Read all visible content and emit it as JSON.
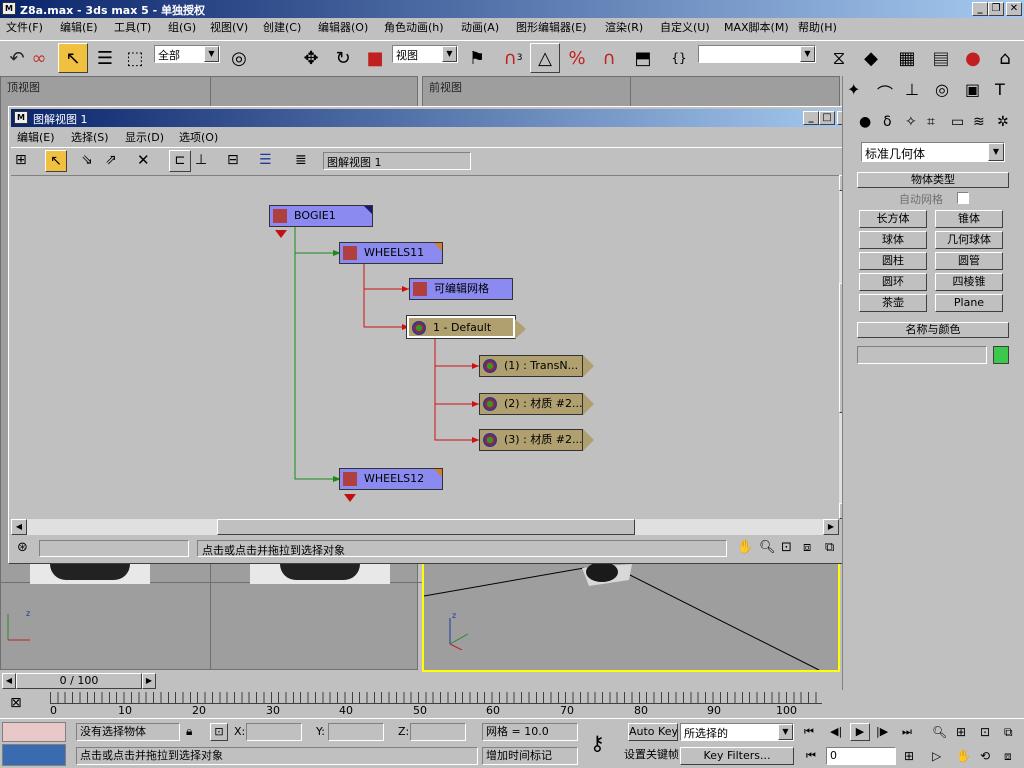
{
  "app": {
    "title": "Z8a.max - 3ds max 5 - 单独授权",
    "min": "_",
    "restore": "❐",
    "close": "✕"
  },
  "menu": [
    "文件(F)",
    "编辑(E)",
    "工具(T)",
    "组(G)",
    "视图(V)",
    "创建(C)",
    "编辑器(O)",
    "角色动画(h)",
    "动画(A)",
    "图形编辑器(E)",
    "渲染(R)",
    "自定义(U)",
    "MAX脚本(M)",
    "帮助(H)"
  ],
  "toolbar": {
    "selection_filter": "全部",
    "ref_coord": "视图",
    "named_selection": "",
    "snap_label": "3"
  },
  "viewports": {
    "top": "顶视图",
    "front": "前视图"
  },
  "schematic": {
    "title": "图解视图 1",
    "menu": [
      "编辑(E)",
      "选择(S)",
      "显示(D)",
      "选项(O)"
    ],
    "name_field": "图解视图 1",
    "status_left": "",
    "status_prompt": "点击或点击并拖拉到选择对象",
    "nodes": {
      "bogie": "BOGIE1",
      "wheels11": "WHEELS11",
      "editable_mesh": "可编辑网格",
      "default_mat": "1 - Default",
      "sub1": "(1) : TransN...",
      "sub2": "(2) : 材质 #2...",
      "sub3": "(3) : 材质 #2...",
      "wheels12": "WHEELS12"
    }
  },
  "command_panel": {
    "category": "标准几何体",
    "object_type_title": "物体类型",
    "autogrid": "自动网格",
    "buttons": [
      "长方体",
      "锥体",
      "球体",
      "几何球体",
      "圆柱",
      "圆管",
      "圆环",
      "四棱锥",
      "茶壶",
      "Plane"
    ],
    "name_color_title": "名称与颜色",
    "name_value": "",
    "swatch_color": "#3cc84a"
  },
  "timeline": {
    "frame_label": "0 / 100",
    "ticks": [
      "0",
      "10",
      "20",
      "30",
      "40",
      "50",
      "60",
      "70",
      "80",
      "90",
      "100"
    ]
  },
  "status": {
    "selection": "没有选择物体",
    "x_label": "X:",
    "y_label": "Y:",
    "z_label": "Z:",
    "x": "",
    "y": "",
    "z": "",
    "grid": "网格 = 10.0",
    "prompt": "点击或点击并拖拉到选择对象",
    "add_time_tag": "增加时间标记",
    "auto_key": "Auto Key",
    "set_key": "设置关键帧",
    "key_mode": "所选择的",
    "key_filters": "Key Filters...",
    "frame_value": "0"
  }
}
